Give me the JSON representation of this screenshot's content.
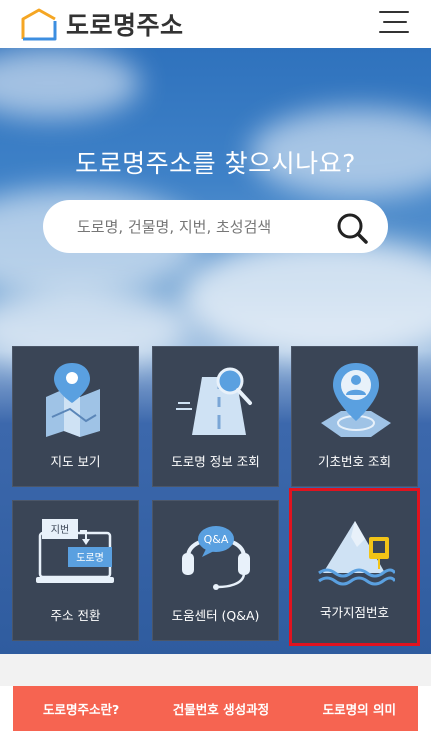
{
  "header": {
    "logo_text": "도로명주소",
    "menu_icon": "hamburger-menu-icon"
  },
  "hero": {
    "title": "도로명주소를 찾으시나요?",
    "search": {
      "placeholder": "도로명, 건물명, 지번, 초성검색",
      "value": "",
      "icon": "search-icon"
    }
  },
  "tiles": [
    {
      "label": "지도 보기",
      "icon": "map-pin-icon"
    },
    {
      "label": "도로명 정보 조회",
      "icon": "road-search-icon"
    },
    {
      "label": "기초번호 조회",
      "icon": "user-location-icon"
    },
    {
      "label": "주소 전환",
      "icon": "address-convert-icon",
      "badge_top": "지번",
      "badge_bottom": "도로명"
    },
    {
      "label": "도움센터 (Q&A)",
      "icon": "headset-icon",
      "bubble": "Q&A"
    },
    {
      "label": "국가지점번호",
      "icon": "mountain-sea-icon"
    }
  ],
  "bottom_links": [
    "도로명주소란?",
    "건물번호 생성과정",
    "도로명의 의미"
  ],
  "colors": {
    "tile_bg": "#3a4556",
    "highlight": "#e0131f",
    "bottom_bar": "#f66451",
    "accent": "#5aa0e0"
  }
}
